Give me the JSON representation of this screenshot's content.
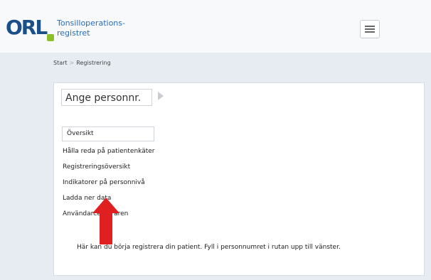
{
  "header": {
    "logo_text": "ORL",
    "app_title_line1": "Tonsilloperations-",
    "app_title_line2": "registret"
  },
  "breadcrumb": {
    "items": [
      "Start",
      "Registrering"
    ],
    "separator": ">"
  },
  "personnr": {
    "label": "Ange personnr."
  },
  "sidebar": {
    "items": [
      {
        "label": "Översikt"
      },
      {
        "label": "Hålla reda på patientenkäter"
      },
      {
        "label": "Registreringsöversikt"
      },
      {
        "label": "Indikatorer på personnivå"
      },
      {
        "label": "Ladda ner data"
      },
      {
        "label": "Användarcenteraren"
      }
    ]
  },
  "main": {
    "message": "Här kan du börja registrera din patient. Fyll i personnumret i rutan upp till vänster."
  },
  "colors": {
    "brand_blue": "#1a4f88",
    "brand_green": "#8bbf2a",
    "arrow_red": "#e02020"
  }
}
